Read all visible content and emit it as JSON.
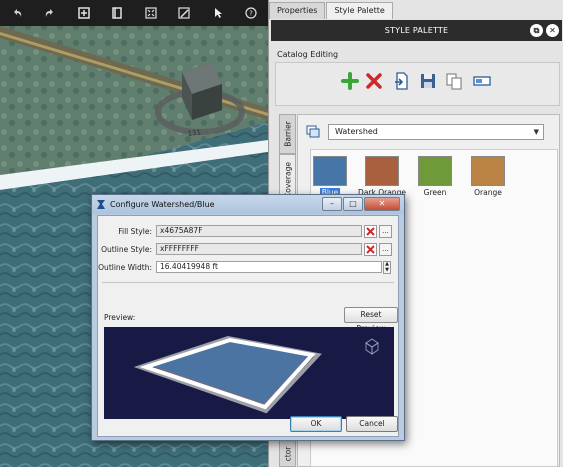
{
  "viewport": {
    "toolbar_icons": [
      "undo-icon",
      "redo-icon",
      "add-icon",
      "book-icon",
      "zoom-extents-icon",
      "edit-style-icon",
      "pointer-icon",
      "help-icon"
    ],
    "marker_number": "131"
  },
  "panel": {
    "tabs": [
      "Properties",
      "Style Palette"
    ],
    "active_tab": "Style Palette",
    "title": "STYLE PALETTE",
    "catalog_label": "Catalog Editing",
    "catalog_buttons": [
      "add-icon",
      "delete-icon",
      "import-icon",
      "save-icon",
      "copy-icon",
      "rename-icon"
    ],
    "side_tabs": [
      "Barrier",
      "Coverage",
      "ctor"
    ],
    "palette_name": "Watershed",
    "swatches": [
      {
        "label": "Blue",
        "color": "#4675a8",
        "selected": true
      },
      {
        "label": "Dark Orange",
        "color": "#a8603f"
      },
      {
        "label": "Green",
        "color": "#6e9a3a"
      },
      {
        "label": "Orange",
        "color": "#b88343"
      }
    ]
  },
  "dialog": {
    "title": "Configure Watershed/Blue",
    "window_buttons": {
      "minimize": "–",
      "maximize": "□",
      "close": "✕"
    },
    "fill_style_label": "Fill Style:",
    "fill_style_value": "x4675A87F",
    "outline_style_label": "Outline Style:",
    "outline_style_value": "xFFFFFFFF",
    "outline_width_label": "Outline Width:",
    "outline_width_value": "16.40419948 ft",
    "ellipsis": "...",
    "preview_label": "Preview:",
    "reset_preview_label": "Reset Preview",
    "ok_label": "OK",
    "cancel_label": "Cancel"
  },
  "colors": {
    "fill": "#4675a8",
    "outline": "#ffffff",
    "accent_red": "#cc2a2a",
    "accent_green": "#3aa63a"
  }
}
